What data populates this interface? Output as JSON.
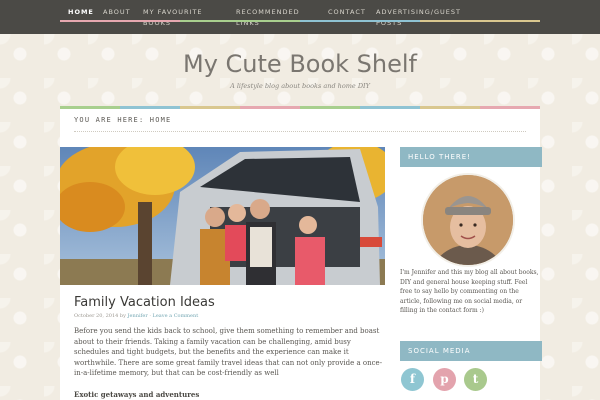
{
  "nav": {
    "items": [
      {
        "label": "HOME"
      },
      {
        "label": "ABOUT"
      },
      {
        "label": "MY FAVOURITE BOOKS"
      },
      {
        "label": "RECOMMENDED LINKS"
      },
      {
        "label": "CONTACT"
      },
      {
        "label": "ADVERTISING/GUEST POSTS"
      }
    ]
  },
  "site": {
    "title": "My Cute Book Shelf",
    "description": "A lifestyle blog about books and home DIY"
  },
  "breadcrumb": "YOU ARE HERE: HOME",
  "post": {
    "title": "Family Vacation Ideas",
    "date": "October 20, 2014",
    "by": "by",
    "author": "Jennifer",
    "separator": " · ",
    "comment_link": "Leave a Comment",
    "excerpt": "Before you send the kids back to school, give them something to remember and boast about to their friends. Taking a family vacation can be challenging, amid busy schedules and tight budgets, but the benefits and the experience can make it worthwhile. There are some great family travel ideas that can not only provide a once-in-a-lifetime memory, but that can be cost-friendly as well",
    "subheading": "Exotic getaways and adventures"
  },
  "sidebar": {
    "hello_title": "HELLO THERE!",
    "about": "I'm Jennifer and this my blog all about books, DIY and general house keeping stuff. Feel free to say hello by commenting on the article, following me on social media, or filling in the contact form :)",
    "social_title": "SOCIAL MEDIA",
    "social": [
      {
        "icon": "facebook-icon",
        "glyph": "f",
        "color": "#8fc6d2"
      },
      {
        "icon": "pinterest-icon",
        "glyph": "p",
        "color": "#e3a3ad"
      },
      {
        "icon": "twitter-icon",
        "glyph": "t",
        "color": "#a9c98d"
      }
    ]
  },
  "colors": {
    "accent_blue": "#8fb8c4",
    "stripe": [
      "#e6a8b0",
      "#a8cf8e",
      "#8fc3d3",
      "#d9c78f"
    ]
  }
}
